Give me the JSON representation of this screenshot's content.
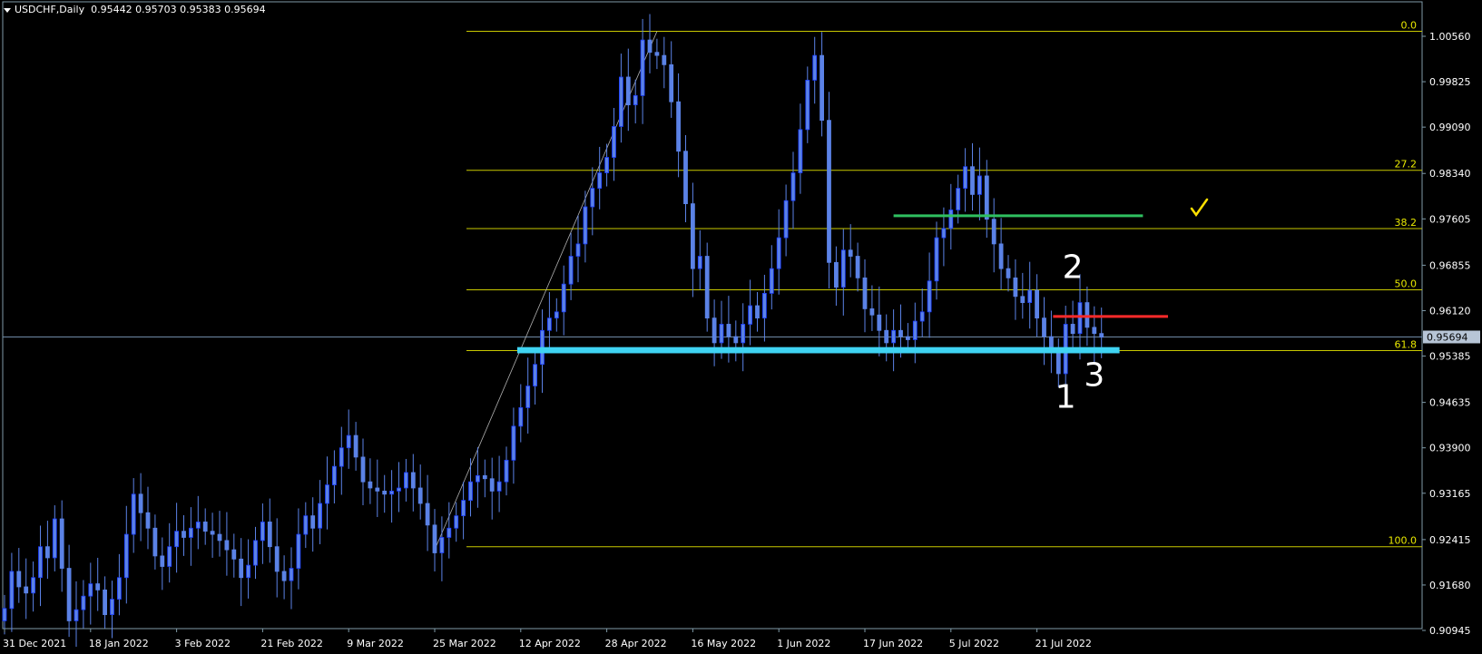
{
  "header": {
    "symbol": "USDCHF,Daily",
    "open": "0.95442",
    "high": "0.95703",
    "low": "0.95383",
    "close": "0.95694"
  },
  "colors": {
    "background": "#000000",
    "axis": "#7f9aa8",
    "candle": "#5b82e6",
    "candle_outline": "#1a3cff",
    "fib": "#c8c800",
    "fib_label": "#e8e800",
    "current_price_line": "#6f8aa6",
    "current_price_box": "#b7c5d6",
    "support_zone": "#3fd3f2",
    "resistance_green": "#2fc060",
    "red_level": "#ff2a2a",
    "checkmark": "#ffe000",
    "axis_text": "#ffffff"
  },
  "chart_data": {
    "type": "candlestick",
    "symbol": "USDCHF",
    "timeframe": "Daily",
    "ylim": [
      0.9058,
      1.0074
    ],
    "price_ticks": [
      "1.00560",
      "0.99825",
      "0.99090",
      "0.98340",
      "0.97605",
      "0.96855",
      "0.96120",
      "0.95385",
      "0.94635",
      "0.93900",
      "0.93165",
      "0.92415",
      "0.91680",
      "0.90945"
    ],
    "date_ticks": [
      {
        "label": "31 Dec 2021",
        "index": 0
      },
      {
        "label": "18 Jan 2022",
        "index": 12
      },
      {
        "label": "3 Feb 2022",
        "index": 24
      },
      {
        "label": "21 Feb 2022",
        "index": 36
      },
      {
        "label": "9 Mar 2022",
        "index": 48
      },
      {
        "label": "25 Mar 2022",
        "index": 60
      },
      {
        "label": "12 Apr 2022",
        "index": 72
      },
      {
        "label": "28 Apr 2022",
        "index": 84
      },
      {
        "label": "16 May 2022",
        "index": 96
      },
      {
        "label": "1 Jun 2022",
        "index": 108
      },
      {
        "label": "17 Jun 2022",
        "index": 120
      },
      {
        "label": "5 Jul 2022",
        "index": 132
      },
      {
        "label": "21 Jul 2022",
        "index": 144
      }
    ],
    "closes": [
      0.913,
      0.919,
      0.9165,
      0.9155,
      0.918,
      0.923,
      0.9212,
      0.9275,
      0.9195,
      0.911,
      0.9128,
      0.915,
      0.917,
      0.916,
      0.912,
      0.9145,
      0.918,
      0.925,
      0.9315,
      0.9285,
      0.926,
      0.9215,
      0.9198,
      0.923,
      0.9255,
      0.9245,
      0.926,
      0.927,
      0.9255,
      0.925,
      0.924,
      0.9225,
      0.921,
      0.918,
      0.92,
      0.924,
      0.927,
      0.923,
      0.919,
      0.9175,
      0.9195,
      0.925,
      0.928,
      0.926,
      0.93,
      0.933,
      0.936,
      0.939,
      0.941,
      0.9375,
      0.9335,
      0.9325,
      0.932,
      0.9315,
      0.932,
      0.9325,
      0.935,
      0.9325,
      0.93,
      0.9265,
      0.922,
      0.9245,
      0.926,
      0.928,
      0.9305,
      0.9335,
      0.9345,
      0.934,
      0.932,
      0.9335,
      0.937,
      0.9425,
      0.9455,
      0.949,
      0.9525,
      0.958,
      0.96,
      0.961,
      0.9655,
      0.97,
      0.972,
      0.978,
      0.981,
      0.9835,
      0.986,
      0.991,
      0.999,
      0.9945,
      0.996,
      1.005,
      1.003,
      1.0025,
      1.001,
      0.995,
      0.987,
      0.9785,
      0.968,
      0.97,
      0.96,
      0.956,
      0.959,
      0.957,
      0.956,
      0.959,
      0.962,
      0.96,
      0.964,
      0.968,
      0.973,
      0.979,
      0.9835,
      0.9905,
      0.9985,
      1.0025,
      0.992,
      0.969,
      0.965,
      0.971,
      0.97,
      0.9665,
      0.9615,
      0.9605,
      0.958,
      0.956,
      0.958,
      0.957,
      0.9565,
      0.9595,
      0.961,
      0.966,
      0.973,
      0.9745,
      0.9775,
      0.981,
      0.9845,
      0.98,
      0.983,
      0.976,
      0.972,
      0.968,
      0.9665,
      0.9635,
      0.9625,
      0.9645,
      0.96,
      0.957,
      0.9545,
      0.951,
      0.959,
      0.9575,
      0.9625,
      0.9585,
      0.9575,
      0.9569
    ],
    "fib_levels": [
      {
        "label": "0.0",
        "price": 1.0064
      },
      {
        "label": "27.2",
        "price": 0.98392
      },
      {
        "label": "38.2",
        "price": 0.97448
      },
      {
        "label": "50.0",
        "price": 0.96458
      },
      {
        "label": "61.8",
        "price": 0.95473
      },
      {
        "label": "100.0",
        "price": 0.923
      }
    ],
    "current_price": "0.95694",
    "support_zone": {
      "from_index": 71,
      "to_index": 154,
      "low": 0.9543,
      "high": 0.9553
    },
    "green_line": {
      "from_index": 124,
      "to_index": 156,
      "price": 0.97655
    },
    "red_line": {
      "from_index": 146,
      "to_index": 160,
      "price": 0.96025
    },
    "trendline": {
      "from_index": 60,
      "from_price": 0.9225,
      "to_index": 91,
      "to_price": 1.0064
    },
    "annotations": [
      {
        "text": "2",
        "index": 149,
        "price": 0.9665
      },
      {
        "text": "1",
        "index": 148,
        "price": 0.9455
      },
      {
        "text": "3",
        "index": 152,
        "price": 0.949
      }
    ]
  }
}
